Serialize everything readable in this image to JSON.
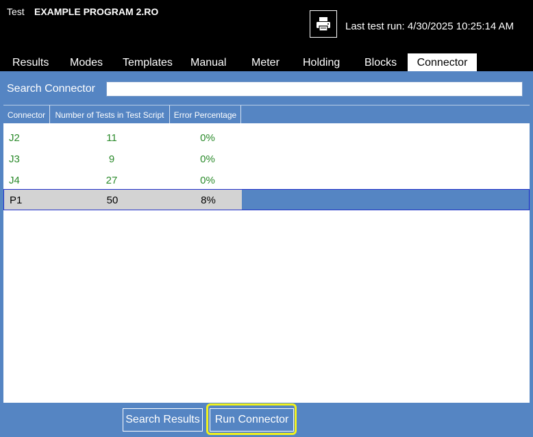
{
  "header": {
    "prefix": "Test",
    "program_name": "EXAMPLE PROGRAM 2.RO",
    "last_run": "Last test run: 4/30/2025 10:25:14 AM",
    "print_icon": "printer-icon"
  },
  "tabs": [
    {
      "label": "Results"
    },
    {
      "label": "Modes"
    },
    {
      "label": "Templates"
    },
    {
      "label": "Manual"
    },
    {
      "label": "Meter"
    },
    {
      "label": "Holding"
    },
    {
      "label": "Blocks"
    },
    {
      "label": "Connector",
      "active": true
    }
  ],
  "search": {
    "label": "Search Connector",
    "value": "",
    "placeholder": ""
  },
  "table": {
    "columns": [
      "Connector",
      "Number of Tests in Test Script",
      "Error Percentage"
    ],
    "rows": [
      {
        "connector": "J2",
        "tests": "11",
        "error": "0%"
      },
      {
        "connector": "J3",
        "tests": "9",
        "error": "0%"
      },
      {
        "connector": "J4",
        "tests": "27",
        "error": "0%"
      },
      {
        "connector": "P1",
        "tests": "50",
        "error": "8%",
        "selected": true
      }
    ]
  },
  "buttons": {
    "search_results": "Search Results",
    "run_connector": "Run Connector"
  },
  "colors": {
    "panel_blue": "#5585c3",
    "row_text_green": "#2a8a2a",
    "highlight_yellow": "#f2f21c"
  }
}
